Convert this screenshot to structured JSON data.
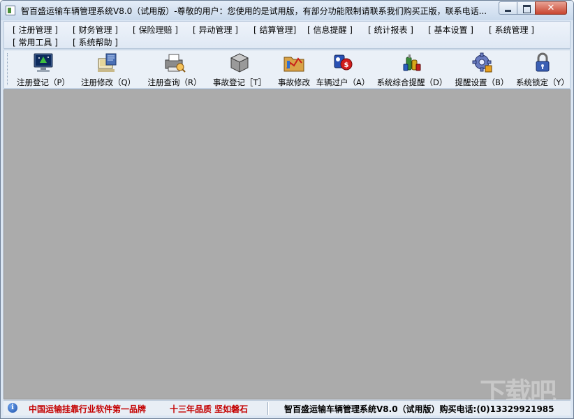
{
  "window": {
    "title": "智百盛运输车辆管理系统V8.0（试用版）-尊敬的用户：您使用的是试用版，有部分功能限制请联系我们购买正版，联系电话...",
    "close_glyph": "✕"
  },
  "menu": {
    "items": [
      {
        "label": "[ 注册管理 ]"
      },
      {
        "label": "[ 财务管理 ]"
      },
      {
        "label": "[ 保险理赔 ]"
      },
      {
        "label": "[ 异动管理 ]"
      },
      {
        "label": "[ 结算管理]"
      },
      {
        "label": "[ 信息提醒 ]"
      },
      {
        "label": "[ 统计报表 ]"
      },
      {
        "label": "[ 基本设置 ]"
      },
      {
        "label": "[ 系统管理 ]"
      },
      {
        "label": "[ 常用工具 ]"
      },
      {
        "label": "[ 系统帮助 ]"
      }
    ]
  },
  "toolbar": {
    "buttons": [
      {
        "label": "注册登记（P）",
        "icon": "monitor-icon"
      },
      {
        "label": "注册修改（Q）",
        "icon": "computer-edit-icon"
      },
      {
        "label": "注册查询（R）",
        "icon": "printer-search-icon"
      },
      {
        "label": "事故登记［T］",
        "icon": "cube-icon"
      },
      {
        "label": "事故修改",
        "icon": "folder-chart-icon"
      },
      {
        "label": "车辆过户（A）",
        "icon": "transfer-icon"
      },
      {
        "label": "系统综合提醒（D）",
        "icon": "alert-bottles-icon"
      },
      {
        "label": "提醒设置（B）",
        "icon": "gear-icon"
      },
      {
        "label": "系统锁定（Y）",
        "icon": "lock-icon"
      }
    ]
  },
  "status": {
    "slogan1": "中国运输挂靠行业软件第一品牌",
    "slogan2": "十三年品质 坚如磐石",
    "product": "智百盛运输车辆管理系统V8.0（试用版）购买电话:(0)13329921985",
    "watermark": "下载吧"
  },
  "colors": {
    "workspace": "#ababab",
    "status_red": "#c40000",
    "titlebar": "#c9d9ec"
  }
}
